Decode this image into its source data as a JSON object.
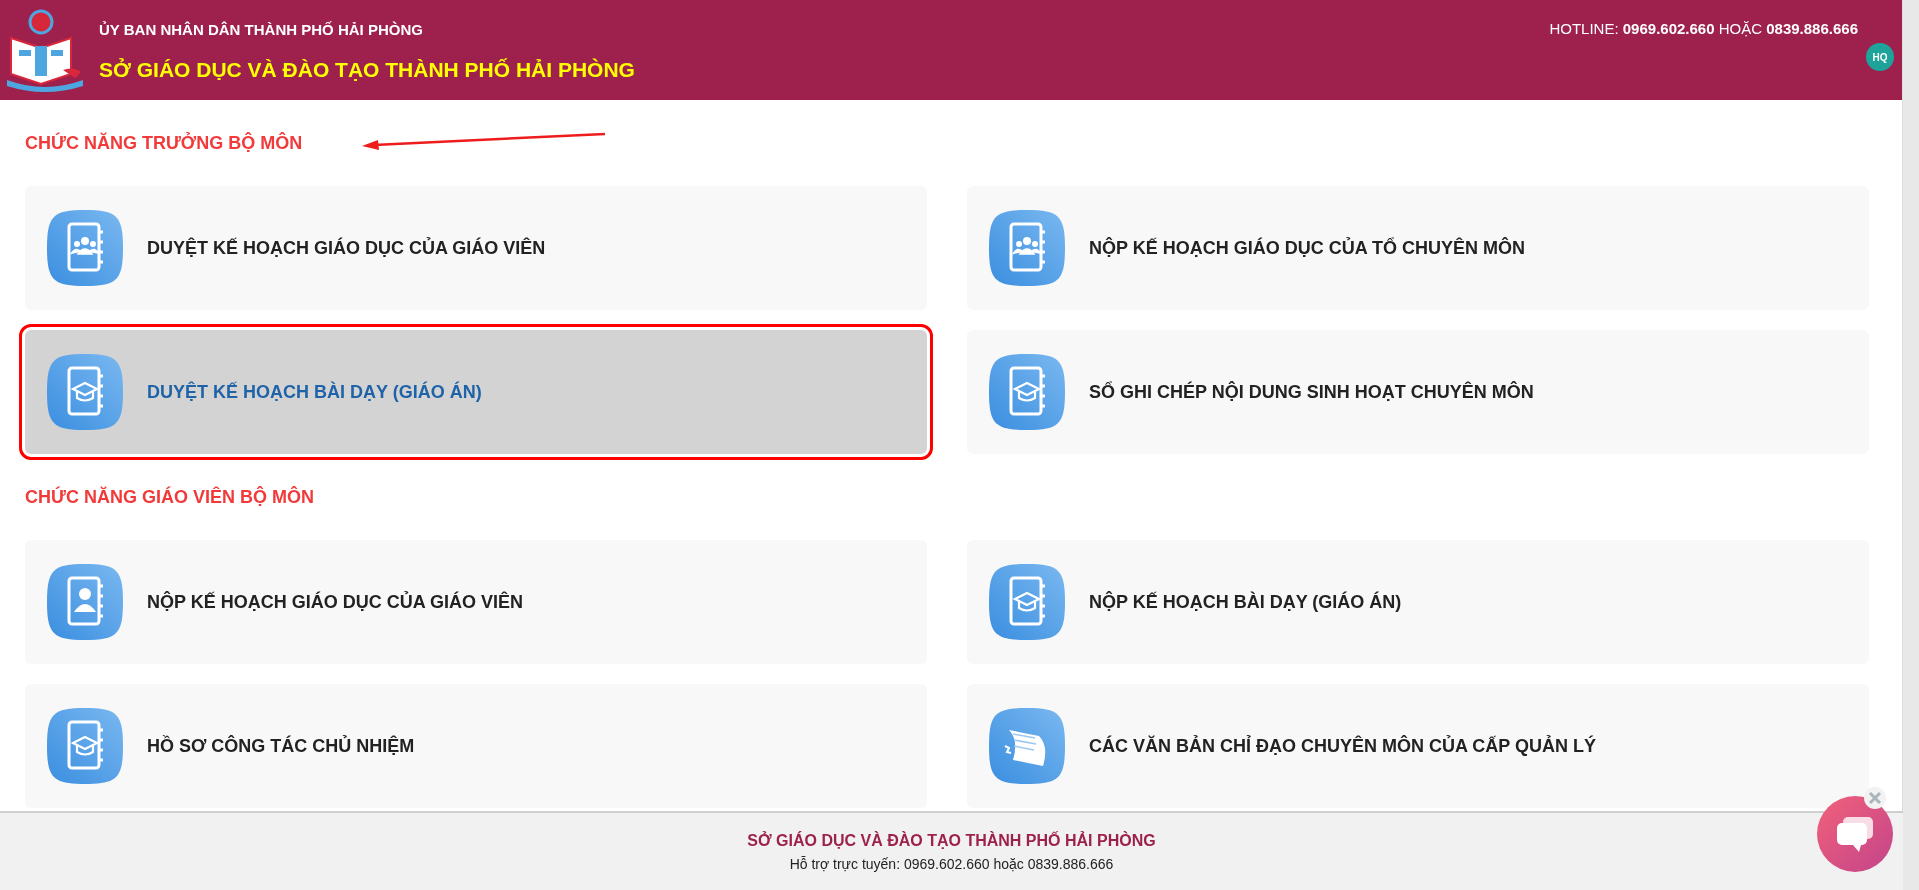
{
  "header": {
    "org": "ỦY BAN NHÂN DÂN THÀNH PHỐ HẢI PHÒNG",
    "title": "SỞ GIÁO DỤC VÀ ĐÀO TẠO THÀNH PHỐ HẢI PHÒNG",
    "hotline_label": "HOTLINE:",
    "hotline_1": "0969.602.660",
    "hotline_or": "HOẶC",
    "hotline_2": "0839.886.666",
    "avatar": "HQ"
  },
  "sections": [
    {
      "title": "CHỨC NĂNG TRƯỞNG BỘ MÔN",
      "cards": [
        {
          "label": "DUYỆT KẾ HOẠCH GIÁO DỤC CỦA GIÁO VIÊN",
          "kind": "group",
          "selected": false
        },
        {
          "label": "NỘP KẾ HOẠCH GIÁO DỤC CỦA TỔ CHUYÊN MÔN",
          "kind": "group",
          "selected": false
        },
        {
          "label": "DUYỆT KẾ HOẠCH BÀI DẠY (GIÁO ÁN)",
          "kind": "cap",
          "selected": true
        },
        {
          "label": "SỔ GHI CHÉP NỘI DUNG SINH HOẠT CHUYÊN MÔN",
          "kind": "cap",
          "selected": false
        }
      ]
    },
    {
      "title": "CHỨC NĂNG GIÁO VIÊN BỘ MÔN",
      "cards": [
        {
          "label": "NỘP KẾ HOẠCH GIÁO DỤC CỦA GIÁO VIÊN",
          "kind": "person",
          "selected": false
        },
        {
          "label": "NỘP KẾ HOẠCH BÀI DẠY (GIÁO ÁN)",
          "kind": "cap",
          "selected": false
        },
        {
          "label": "HỒ SƠ CÔNG TÁC CHỦ NHIỆM",
          "kind": "cap",
          "selected": false
        },
        {
          "label": "CÁC VĂN BẢN CHỈ ĐẠO CHUYÊN MÔN CỦA CẤP QUẢN LÝ",
          "kind": "papers",
          "selected": false
        }
      ]
    }
  ],
  "footer": {
    "title": "SỞ GIÁO DỤC VÀ ĐÀO TẠO THÀNH PHỐ HẢI PHÒNG",
    "support": "Hỗ trợ trực tuyến: 0969.602.660 hoặc 0839.886.666"
  }
}
